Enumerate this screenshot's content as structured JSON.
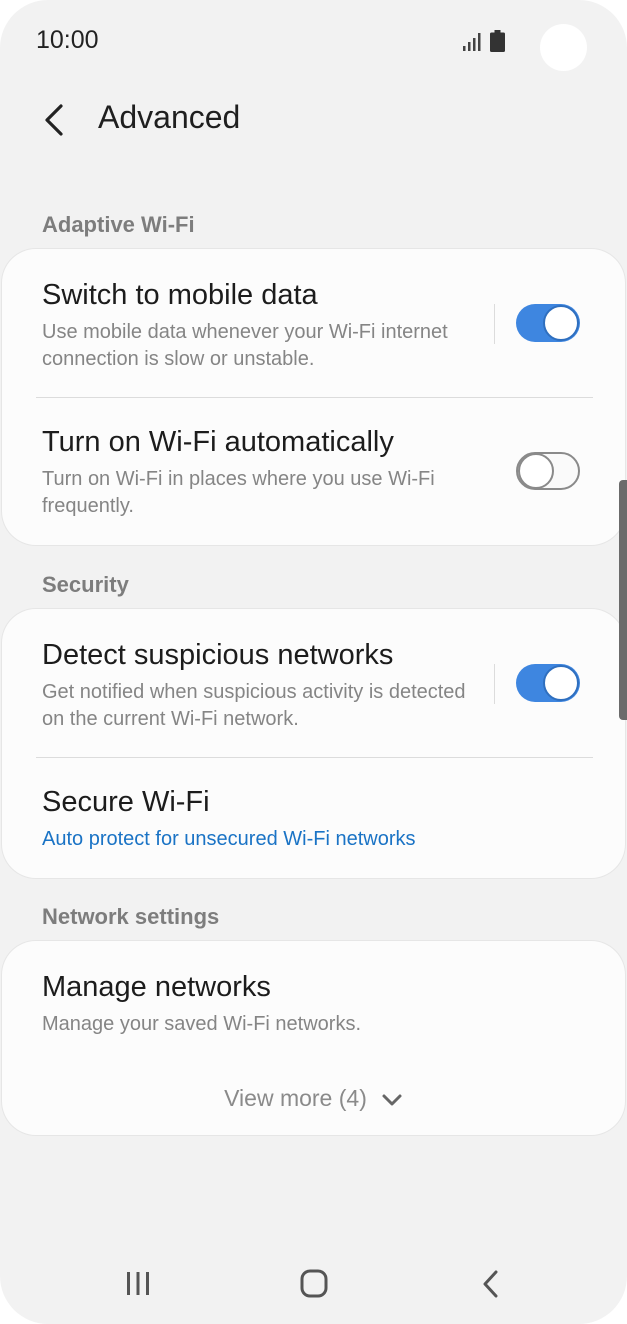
{
  "status_bar": {
    "time": "10:00",
    "icons": [
      "signal-icon",
      "battery-icon"
    ]
  },
  "app_bar": {
    "back_icon": "chevron-left-icon",
    "title": "Advanced"
  },
  "sections": {
    "adaptive_wifi": {
      "header": "Adaptive Wi-Fi",
      "items": [
        {
          "title": "Switch to mobile data",
          "subtitle": "Use mobile data whenever your Wi-Fi internet connection is slow or unstable.",
          "toggle": true
        },
        {
          "title": "Turn on Wi-Fi automatically",
          "subtitle": "Turn on Wi-Fi in places where you use Wi-Fi frequently.",
          "toggle": false
        }
      ]
    },
    "security": {
      "header": "Security",
      "items": [
        {
          "title": "Detect suspicious networks",
          "subtitle": "Get notified when suspicious activity is detected on the current Wi-Fi network.",
          "toggle": true
        },
        {
          "title": "Secure Wi-Fi",
          "subtitle": "Auto protect for unsecured Wi-Fi networks"
        }
      ]
    },
    "network_settings": {
      "header": "Network settings",
      "items": [
        {
          "title": "Manage networks",
          "subtitle": "Manage your saved Wi-Fi networks."
        }
      ],
      "view_more": "View more (4)"
    }
  },
  "nav_bar": {
    "icons": [
      "recent-apps-icon",
      "home-icon",
      "back-icon"
    ]
  },
  "colors": {
    "accent": "#3e86e0",
    "link": "#1a73c5",
    "background": "#f2f2f2",
    "card": "#fcfcfc"
  }
}
